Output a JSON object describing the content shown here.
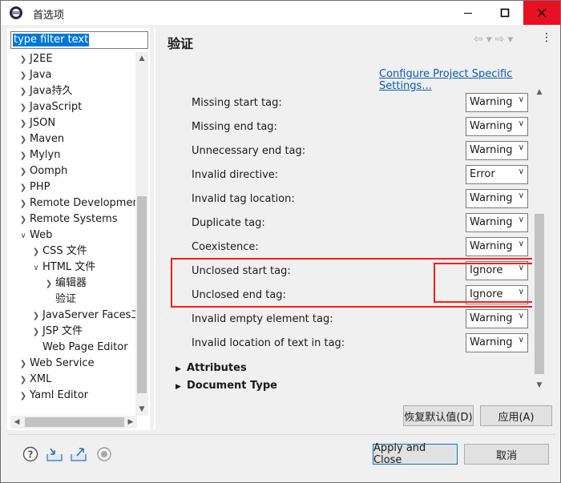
{
  "window": {
    "title": "首选项",
    "controls": {
      "minimize": "minimize-icon",
      "maximize": "maximize-icon",
      "close": "close-icon"
    }
  },
  "sidebar": {
    "filter_placeholder": "type filter text",
    "items": [
      {
        "label": "J2EE",
        "level": 0,
        "expander": "collapsed"
      },
      {
        "label": "Java",
        "level": 0,
        "expander": "collapsed"
      },
      {
        "label": "Java持久",
        "level": 0,
        "expander": "collapsed"
      },
      {
        "label": "JavaScript",
        "level": 0,
        "expander": "collapsed"
      },
      {
        "label": "JSON",
        "level": 0,
        "expander": "collapsed"
      },
      {
        "label": "Maven",
        "level": 0,
        "expander": "collapsed"
      },
      {
        "label": "Mylyn",
        "level": 0,
        "expander": "collapsed"
      },
      {
        "label": "Oomph",
        "level": 0,
        "expander": "collapsed"
      },
      {
        "label": "PHP",
        "level": 0,
        "expander": "collapsed"
      },
      {
        "label": "Remote Development",
        "level": 0,
        "expander": "collapsed"
      },
      {
        "label": "Remote Systems",
        "level": 0,
        "expander": "collapsed"
      },
      {
        "label": "Web",
        "level": 0,
        "expander": "expanded"
      },
      {
        "label": "CSS 文件",
        "level": 1,
        "expander": "collapsed"
      },
      {
        "label": "HTML 文件",
        "level": 1,
        "expander": "expanded"
      },
      {
        "label": "编辑器",
        "level": 2,
        "expander": "collapsed"
      },
      {
        "label": "验证",
        "level": 2,
        "expander": "none",
        "selected": true
      },
      {
        "label": "JavaServer Faces工具",
        "level": 1,
        "expander": "collapsed"
      },
      {
        "label": "JSP 文件",
        "level": 1,
        "expander": "collapsed"
      },
      {
        "label": "Web Page Editor",
        "level": 1,
        "expander": "none"
      },
      {
        "label": "Web Service",
        "level": 0,
        "expander": "collapsed"
      },
      {
        "label": "XML",
        "level": 0,
        "expander": "collapsed"
      },
      {
        "label": "Yaml Editor",
        "level": 0,
        "expander": "collapsed"
      }
    ]
  },
  "main": {
    "title": "验证",
    "config_link": "Configure Project Specific Settings...",
    "rows": [
      {
        "label": "Missing start tag:",
        "value": "Warning"
      },
      {
        "label": "Missing end tag:",
        "value": "Warning"
      },
      {
        "label": "Unnecessary end tag:",
        "value": "Warning"
      },
      {
        "label": "Invalid directive:",
        "value": "Error"
      },
      {
        "label": "Invalid tag location:",
        "value": "Warning"
      },
      {
        "label": "Duplicate tag:",
        "value": "Warning"
      },
      {
        "label": "Coexistence:",
        "value": "Warning"
      },
      {
        "label": "Unclosed start tag:",
        "value": "Ignore"
      },
      {
        "label": "Unclosed end tag:",
        "value": "Ignore"
      },
      {
        "label": "Invalid empty element tag:",
        "value": "Warning"
      },
      {
        "label": "Invalid location of text in tag:",
        "value": "Warning"
      }
    ],
    "sections": [
      "Attributes",
      "Document Type"
    ],
    "restore_defaults": "恢复默认值(D)",
    "apply": "应用(A)"
  },
  "footer": {
    "apply_and_close": "Apply and Close",
    "cancel": "取消",
    "icons": [
      "help-icon",
      "import-icon",
      "export-icon",
      "record-icon"
    ]
  },
  "colors": {
    "highlight": "#ff1a1a",
    "selection": "#0078d7",
    "link": "#0b5bbf"
  }
}
